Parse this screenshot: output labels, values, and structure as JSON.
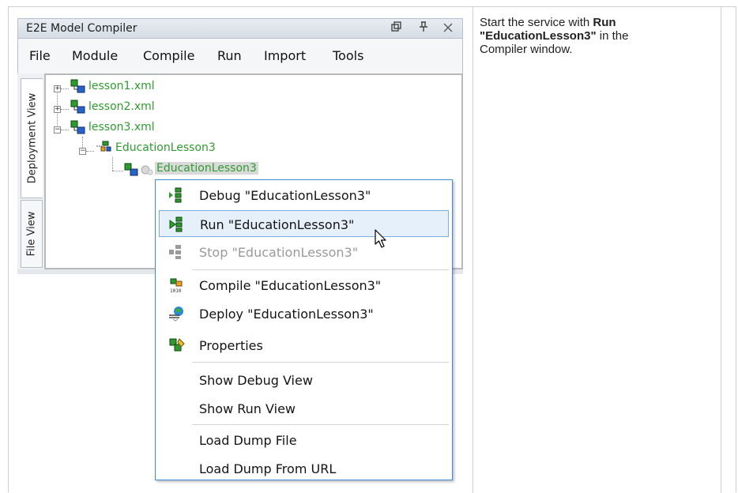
{
  "window": {
    "title": "E2E Model Compiler",
    "controls": [
      "restore",
      "pin",
      "close"
    ]
  },
  "menubar": [
    "File",
    "Module",
    "Compile",
    "Run",
    "Import",
    "Tools"
  ],
  "side_tabs": [
    "Deployment View",
    "File View"
  ],
  "tree": {
    "files": [
      "lesson1.xml",
      "lesson2.xml",
      "lesson3.xml"
    ],
    "service": "EducationLesson3",
    "selected_module": "EducationLesson3"
  },
  "context_menu": {
    "items": [
      {
        "label": "Debug \"EducationLesson3\"",
        "icon": "debug-icon"
      },
      {
        "label": "Run \"EducationLesson3\"",
        "icon": "run-icon",
        "state": "hover"
      },
      {
        "label": "Stop \"EducationLesson3\"",
        "icon": "stop-icon",
        "state": "disabled"
      },
      {
        "label": "Compile \"EducationLesson3\"",
        "icon": "compile-icon"
      },
      {
        "label": "Deploy \"EducationLesson3\"",
        "icon": "deploy-icon"
      },
      {
        "label": "Properties",
        "icon": "properties-icon"
      },
      {
        "label": "Show Debug View"
      },
      {
        "label": "Show Run View"
      },
      {
        "label": "Load Dump File"
      },
      {
        "label": "Load Dump From URL"
      }
    ]
  },
  "instructions": {
    "prefix": "Start the service with ",
    "bold": "Run \"EducationLesson3\"",
    "suffix": " in the Compiler window."
  }
}
